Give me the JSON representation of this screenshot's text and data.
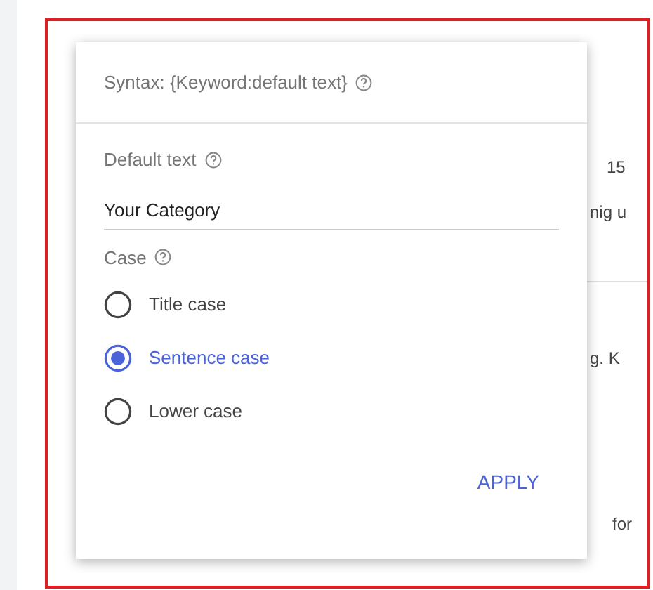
{
  "background_fragments": [
    "15",
    "nig u",
    "g. K",
    "for"
  ],
  "popup": {
    "syntax": "Syntax: {Keyword:default text}",
    "default_text": {
      "label": "Default text",
      "value": "Your Category"
    },
    "case": {
      "label": "Case",
      "options": [
        {
          "label": "Title case",
          "selected": false
        },
        {
          "label": "Sentence case",
          "selected": true
        },
        {
          "label": "Lower case",
          "selected": false
        }
      ]
    },
    "apply_button": "APPLY"
  }
}
